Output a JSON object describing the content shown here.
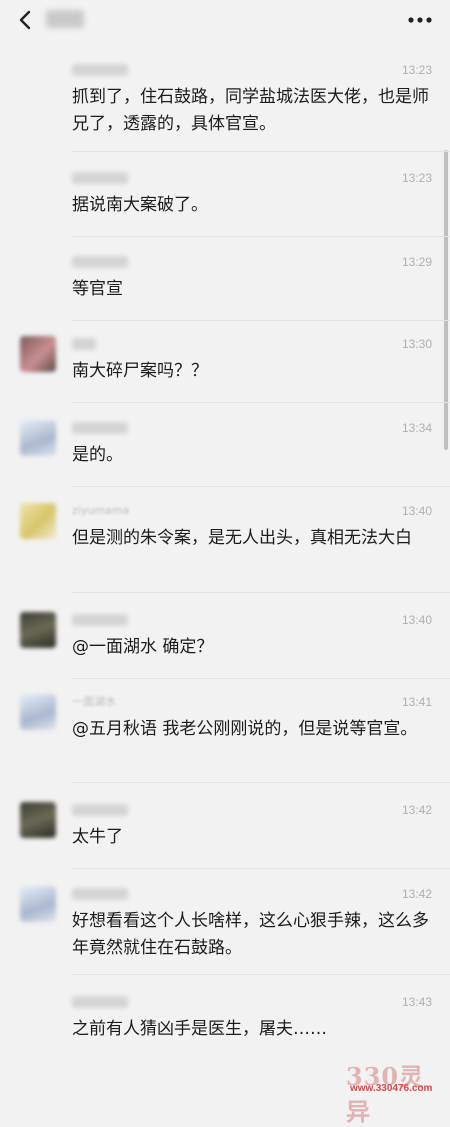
{
  "header": {
    "back_icon": "chevron-left-icon",
    "more_icon": "more-dots-icon"
  },
  "messages": [
    {
      "name": "",
      "time": "13:23",
      "text": "抓到了，住石鼓路，同学盐城法医大佬，也是师兄了，透露的，具体官宣。"
    },
    {
      "name": "",
      "time": "13:23",
      "text": "据说南大案破了。"
    },
    {
      "name": "",
      "time": "13:29",
      "text": "等官宣"
    },
    {
      "name": "",
      "time": "13:30",
      "text": "南大碎尸案吗？？"
    },
    {
      "name": "",
      "time": "13:34",
      "text": "是的。"
    },
    {
      "name": "ziyumama",
      "time": "13:40",
      "text": "但是测的朱令案，是无人出头，真相无法大白"
    },
    {
      "name": "",
      "time": "13:40",
      "text": "@一面湖水 确定？"
    },
    {
      "name": "一面湖水",
      "time": "13:41",
      "text": "@五月秋语 我老公刚刚说的，但是说等官宣。"
    },
    {
      "name": "",
      "time": "13:42",
      "text": "太牛了"
    },
    {
      "name": "",
      "time": "13:42",
      "text": "好想看看这个人长啥样，这么心狠手辣，这么多年竟然就住在石鼓路。"
    },
    {
      "name": "",
      "time": "13:43",
      "text": "之前有人猜凶手是医生，屠夫……"
    }
  ],
  "watermark": {
    "big": "330灵异",
    "url": "www.330476.com"
  },
  "colors": {
    "background": "#f2f2f2",
    "text": "#1c1c1c",
    "time": "#b0b0b0",
    "watermark": "#d24b4b"
  }
}
